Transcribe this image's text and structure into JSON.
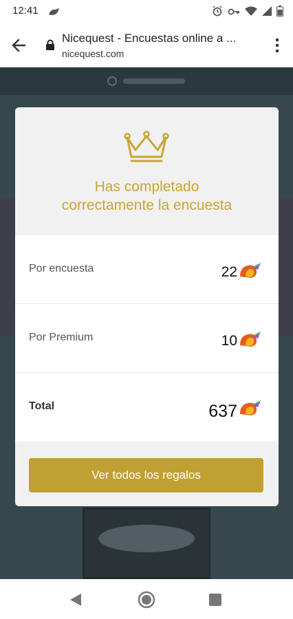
{
  "status_bar": {
    "time": "12:41",
    "icons": [
      "notification-icon",
      "alarm-icon",
      "key-icon",
      "wifi-icon",
      "signal-icon",
      "battery-icon"
    ]
  },
  "browser": {
    "title": "Nicequest - Encuestas online a ...",
    "domain": "nicequest.com"
  },
  "modal": {
    "title_line1": "Has completado",
    "title_line2": "correctamente la encuesta",
    "rows": [
      {
        "label": "Por encuesta",
        "value": "22"
      },
      {
        "label": "Por Premium",
        "value": "10"
      },
      {
        "label": "Total",
        "value": "637"
      }
    ],
    "button_label": "Ver todos los regalos"
  },
  "colors": {
    "accent_gold": "#c1a033",
    "title_gold": "#c8a535",
    "overlay_bg": "#36474e"
  }
}
